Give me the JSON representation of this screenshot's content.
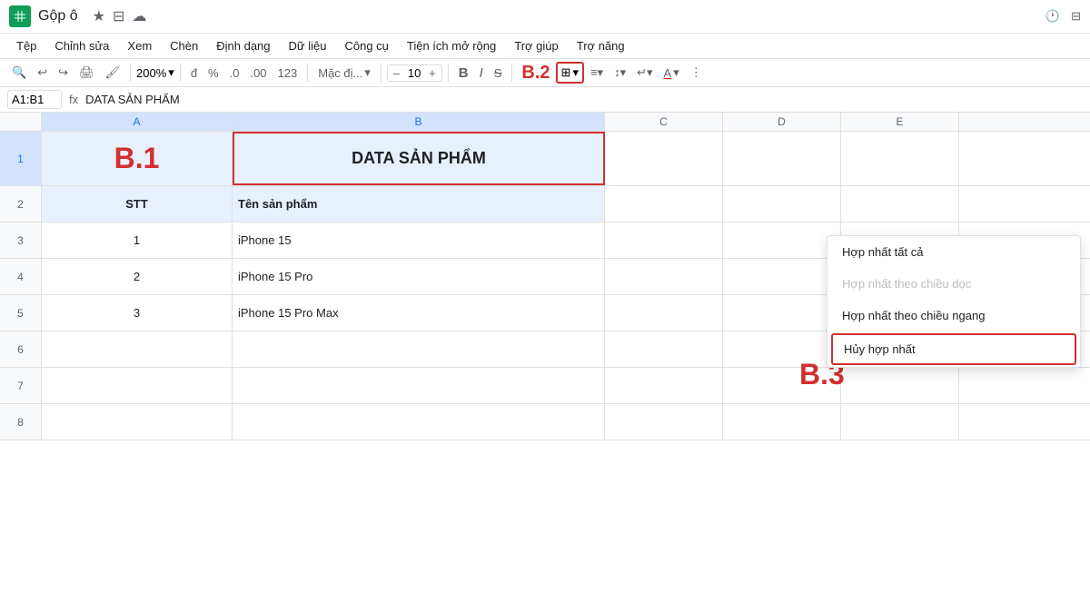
{
  "titleBar": {
    "docTitle": "Gộp ô",
    "icons": [
      "★",
      "⊟",
      "☁"
    ]
  },
  "menuBar": {
    "items": [
      "Tệp",
      "Chỉnh sửa",
      "Xem",
      "Chèn",
      "Định dạng",
      "Dữ liệu",
      "Công cụ",
      "Tiện ích mở rộng",
      "Trợ giúp",
      "Trợ năng"
    ]
  },
  "toolbar": {
    "search": "🔍",
    "undo": "↩",
    "redo": "↪",
    "print": "🖨",
    "format_paint": "🖌",
    "zoom": "200%",
    "currency": "đ",
    "percent": "%",
    "decimal_decrease": ".0",
    "decimal_increase": ".00",
    "format_123": "123",
    "font_family": "Mặc đị...",
    "font_size": "10",
    "font_size_decrease": "–",
    "font_size_increase": "+",
    "bold": "B",
    "italic": "I",
    "strikethrough": "S̶",
    "b2_label": "B.2",
    "merge_icon": "⊞",
    "align_left": "≡",
    "valign": "↕",
    "wrap": "↵",
    "text_color": "A"
  },
  "formulaBar": {
    "cellRef": "A1:B1",
    "fx": "fx",
    "formula": "DATA SẢN PHẨM"
  },
  "columns": {
    "headers": [
      "A",
      "B",
      "C",
      "D",
      "E"
    ],
    "selectedCols": [
      "A",
      "B"
    ]
  },
  "rows": [
    {
      "rowNum": "1",
      "selected": true,
      "cells": [
        {
          "col": "A",
          "value": "B.1",
          "type": "b1"
        },
        {
          "col": "B",
          "value": "DATA  SẢN PHẨM",
          "type": "merged-header"
        },
        {
          "col": "C",
          "value": ""
        },
        {
          "col": "D",
          "value": ""
        },
        {
          "col": "E",
          "value": ""
        }
      ]
    },
    {
      "rowNum": "2",
      "selected": false,
      "cells": [
        {
          "col": "A",
          "value": "STT",
          "type": "header center"
        },
        {
          "col": "B",
          "value": "Tên sản phẩm",
          "type": "header"
        },
        {
          "col": "C",
          "value": ""
        },
        {
          "col": "D",
          "value": ""
        },
        {
          "col": "E",
          "value": ""
        }
      ]
    },
    {
      "rowNum": "3",
      "selected": false,
      "cells": [
        {
          "col": "A",
          "value": "1",
          "type": "center"
        },
        {
          "col": "B",
          "value": "iPhone 15",
          "type": ""
        },
        {
          "col": "C",
          "value": ""
        },
        {
          "col": "D",
          "value": ""
        },
        {
          "col": "E",
          "value": ""
        }
      ]
    },
    {
      "rowNum": "4",
      "selected": false,
      "cells": [
        {
          "col": "A",
          "value": "2",
          "type": "center"
        },
        {
          "col": "B",
          "value": "iPhone 15 Pro",
          "type": ""
        },
        {
          "col": "C",
          "value": ""
        },
        {
          "col": "D",
          "value": ""
        },
        {
          "col": "E",
          "value": ""
        }
      ]
    },
    {
      "rowNum": "5",
      "selected": false,
      "cells": [
        {
          "col": "A",
          "value": "3",
          "type": "center"
        },
        {
          "col": "B",
          "value": "iPhone 15 Pro Max",
          "type": ""
        },
        {
          "col": "C",
          "value": ""
        },
        {
          "col": "D",
          "value": ""
        },
        {
          "col": "E",
          "value": ""
        }
      ]
    },
    {
      "rowNum": "6",
      "cells": [
        {
          "col": "A",
          "value": ""
        },
        {
          "col": "B",
          "value": ""
        },
        {
          "col": "C",
          "value": ""
        },
        {
          "col": "D",
          "value": ""
        },
        {
          "col": "E",
          "value": ""
        }
      ]
    },
    {
      "rowNum": "7",
      "cells": [
        {
          "col": "A",
          "value": ""
        },
        {
          "col": "B",
          "value": ""
        },
        {
          "col": "C",
          "value": ""
        },
        {
          "col": "D",
          "value": ""
        },
        {
          "col": "E",
          "value": ""
        }
      ]
    },
    {
      "rowNum": "8",
      "cells": [
        {
          "col": "A",
          "value": ""
        },
        {
          "col": "B",
          "value": ""
        },
        {
          "col": "C",
          "value": ""
        },
        {
          "col": "D",
          "value": ""
        },
        {
          "col": "E",
          "value": ""
        }
      ]
    }
  ],
  "dropdownMenu": {
    "items": [
      {
        "label": "Hợp nhất tất cả",
        "disabled": false
      },
      {
        "label": "Hợp nhất theo chiều dọc",
        "disabled": true
      },
      {
        "label": "Hợp nhất theo chiều ngang",
        "disabled": false
      },
      {
        "label": "Hủy hợp nhất",
        "disabled": false,
        "highlighted": true
      }
    ]
  },
  "b3_label": "B.3",
  "rightIcons": [
    "🕐",
    "⊟"
  ]
}
